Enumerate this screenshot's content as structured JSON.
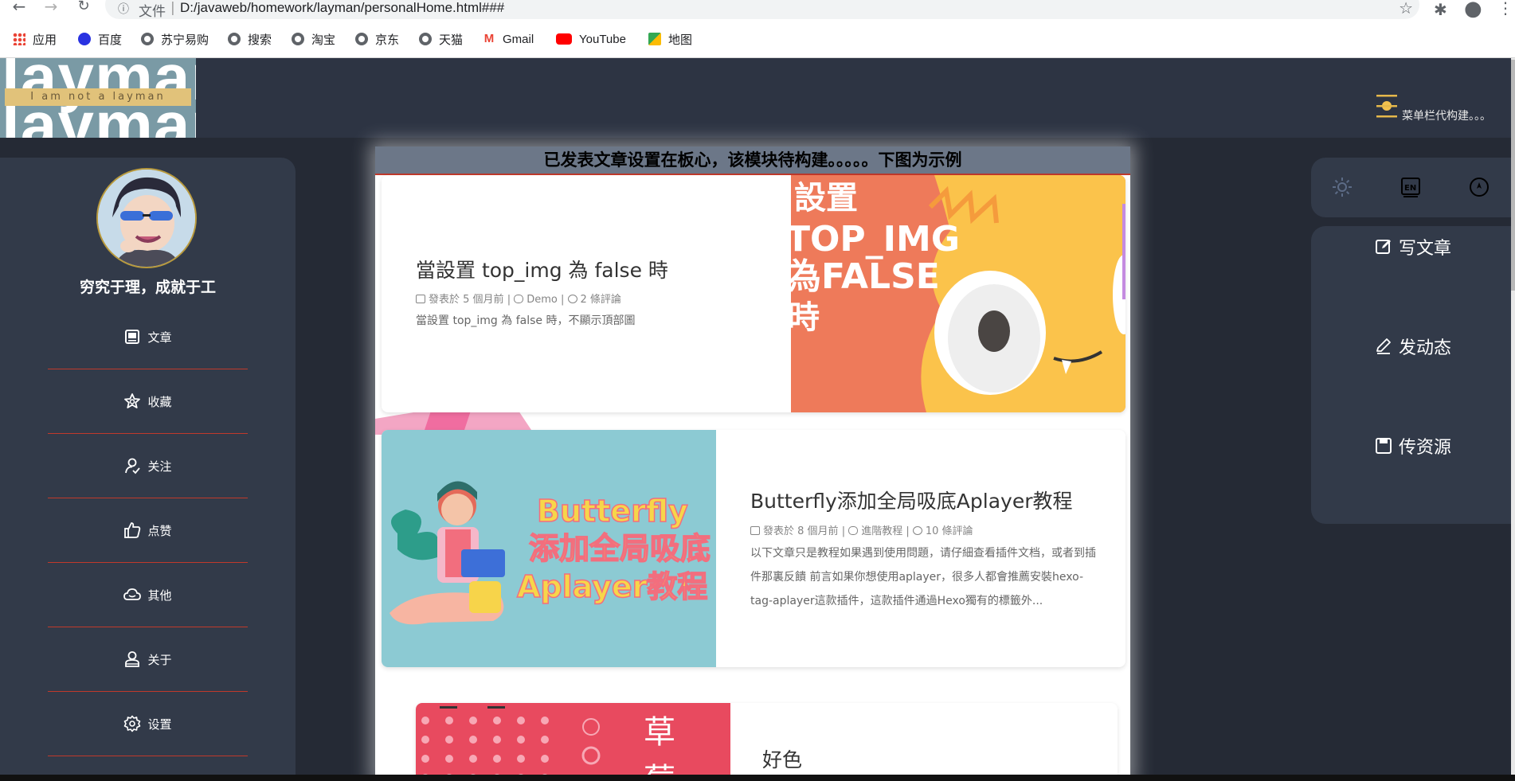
{
  "browser": {
    "address_label": "文件",
    "url": "D:/javaweb/homework/layman/personalHome.html###",
    "bookmarks": [
      {
        "label": "应用",
        "icon": "apps-grid-icon"
      },
      {
        "label": "百度",
        "icon": "baidu-paw-icon"
      },
      {
        "label": "苏宁易购",
        "icon": "globe-icon"
      },
      {
        "label": "搜索",
        "icon": "globe-icon"
      },
      {
        "label": "淘宝",
        "icon": "globe-icon"
      },
      {
        "label": "京东",
        "icon": "globe-icon"
      },
      {
        "label": "天猫",
        "icon": "globe-icon"
      },
      {
        "label": "Gmail",
        "icon": "gmail-icon"
      },
      {
        "label": "YouTube",
        "icon": "youtube-icon"
      },
      {
        "label": "地图",
        "icon": "maps-pin-icon"
      }
    ]
  },
  "header": {
    "logo_text": "layman",
    "logo_tagline": "I am not a layman",
    "menu_text": "菜单栏代构建。。。"
  },
  "sidebar": {
    "motto": "穷究于理，成就于工",
    "items": [
      {
        "label": "文章",
        "icon": "article-icon"
      },
      {
        "label": "收藏",
        "icon": "star-icon"
      },
      {
        "label": "关注",
        "icon": "user-follow-icon"
      },
      {
        "label": "点赞",
        "icon": "thumbs-up-icon"
      },
      {
        "label": "其他",
        "icon": "cloud-icon"
      },
      {
        "label": "关于",
        "icon": "person-icon"
      },
      {
        "label": "设置",
        "icon": "gear-icon"
      }
    ]
  },
  "main": {
    "notice": "已发表文章设置在板心，该模块待构建。。。。。下图为示例",
    "posts": [
      {
        "title": "當設置 top_img 為 false 時",
        "date": "發表於 5 個月前",
        "category": "Demo",
        "comments": "2 條評論",
        "excerpt": "當設置 top_img 為 false 時，不顯示頂部圖",
        "cover_text": "設置\nTOP_IMG\n為FALSE\n時"
      },
      {
        "title": "Butterfly添加全局吸底Aplayer教程",
        "date": "發表於 8 個月前",
        "category": "進階教程",
        "comments": "10 條評論",
        "excerpt": "以下文章只是教程如果遇到使用問題，请仔細查看插件文档，或者到插件那裏反饋 前言如果你想使用aplayer，很多人都會推薦安裝hexo-tag-aplayer這款插件，這款插件通過Hexo獨有的標籤外...",
        "cover_text": "Butterfly\n添加全局吸底\nAplayer教程"
      },
      {
        "title": "好色",
        "cover_text": "草\n莓"
      }
    ]
  },
  "right": {
    "toolbar": [
      {
        "icon": "sun-icon"
      },
      {
        "icon": "language-en-icon"
      },
      {
        "icon": "compass-icon"
      }
    ],
    "actions": [
      {
        "label": "写文章",
        "icon": "edit-square-icon"
      },
      {
        "label": "发动态",
        "icon": "pen-icon"
      },
      {
        "label": "传资源",
        "icon": "save-icon"
      }
    ]
  }
}
